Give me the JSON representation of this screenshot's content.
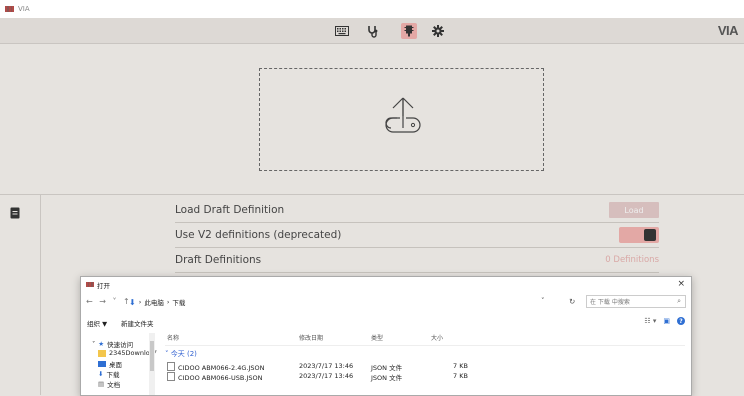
{
  "window": {
    "title": "VIA"
  },
  "navbar": {
    "icons": [
      "keyboard-icon",
      "stethoscope-icon",
      "chip-icon",
      "gear-icon"
    ],
    "brand": "VIA",
    "active_color": "#e3a8a5"
  },
  "dropzone": {
    "icon": "upload-icon"
  },
  "settings": {
    "rows": [
      {
        "label": "Load Draft Definition",
        "control": "Load"
      },
      {
        "label": "Use V2 definitions (deprecated)",
        "control": "toggle"
      },
      {
        "label": "Draft Definitions",
        "control": "0 Definitions"
      }
    ]
  },
  "dialog": {
    "title": "打开",
    "close": "×",
    "breadcrumb": [
      "此电脑",
      "下载"
    ],
    "search_placeholder": "在 下载 中搜索",
    "toolbar": {
      "organize": "组织 ▼",
      "new_folder": "新建文件夹"
    },
    "nav_pane": [
      {
        "label": "快速访问",
        "icon": "star-icon"
      },
      {
        "label": "2345Downlo ✐",
        "icon": "folder-icon"
      },
      {
        "label": "桌面",
        "icon": "desktop-icon"
      },
      {
        "label": "下载",
        "icon": "download-icon"
      },
      {
        "label": "文档",
        "icon": "document-icon"
      }
    ],
    "columns": [
      "名称",
      "修改日期",
      "类型",
      "大小"
    ],
    "group": "今天 (2)",
    "files": [
      {
        "name": "CIDOO ABM066-2.4G.JSON",
        "date": "2023/7/17 13:46",
        "type": "JSON 文件",
        "size": "7 KB"
      },
      {
        "name": "CIDOO ABM066-USB.JSON",
        "date": "2023/7/17 13:46",
        "type": "JSON 文件",
        "size": "7 KB"
      }
    ]
  }
}
